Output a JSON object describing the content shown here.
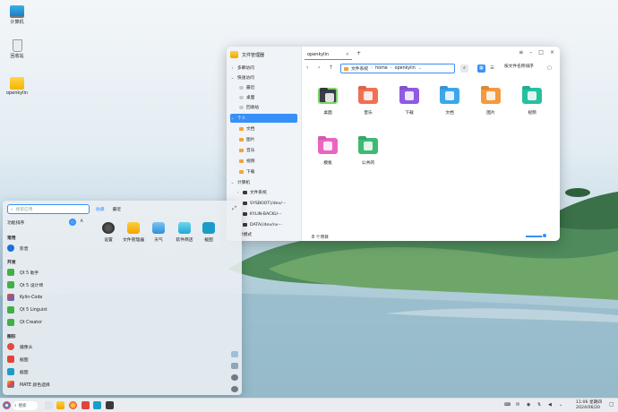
{
  "desktop": {
    "icons": [
      {
        "label": "计算机",
        "icon": "computer-icon"
      },
      {
        "label": "回收站",
        "icon": "trash-icon"
      },
      {
        "label": "openkylin",
        "icon": "home-folder-icon"
      }
    ]
  },
  "file_manager": {
    "title": "文件管理器",
    "tab": "openkylin",
    "path": [
      "文件系统",
      "home",
      "openkylin"
    ],
    "sort_label": "按文件名称排序",
    "sidebar": {
      "recent_group": "多瞬访问",
      "quick_group": "快速访问",
      "quick_items": [
        "最近",
        "桌面",
        "回收站"
      ],
      "personal_group": "个人",
      "personal_items": [
        "文档",
        "图片",
        "音乐",
        "视频",
        "下载"
      ],
      "computer_group": "计算机",
      "computer_items": [
        "文件系统",
        "SYSBOOT(/dev/···",
        "KYLIN-BACKU···",
        "DATA(/dev/nv···"
      ],
      "mode": "计模式"
    },
    "items": [
      {
        "label": "桌面",
        "color": "#3a3d47"
      },
      {
        "label": "音乐",
        "color": "#f16f53"
      },
      {
        "label": "下载",
        "color": "#8f5be0"
      },
      {
        "label": "文档",
        "color": "#3ca6ea"
      },
      {
        "label": "图片",
        "color": "#f39a3c"
      },
      {
        "label": "视频",
        "color": "#25c19f"
      },
      {
        "label": "模板",
        "color": "#e965c0"
      },
      {
        "label": "公共的",
        "color": "#3dba74"
      }
    ],
    "item_count": "8 个项目"
  },
  "start_menu": {
    "search_placeholder": "搜索应用",
    "tabs": [
      "收藏",
      "最近"
    ],
    "sort_label": "功能排序",
    "sections": [
      {
        "title": "常用",
        "apps": [
          "影音"
        ]
      },
      {
        "title": "开发",
        "apps": [
          "Qt 5 助手",
          "Qt 5 设计师",
          "Kylin-Code",
          "Qt 5 Linguist",
          "Qt Creator"
        ]
      },
      {
        "title": "图形",
        "apps": [
          "摄像头",
          "截图",
          "截图",
          "MATE 颜色选择"
        ]
      }
    ],
    "favorites": [
      "设置",
      "文件管理器",
      "天气",
      "软件商店",
      "截图"
    ]
  },
  "taskbar": {
    "search_label": "搜索",
    "time": "11:06 星期四",
    "date": "2024/06/20"
  }
}
